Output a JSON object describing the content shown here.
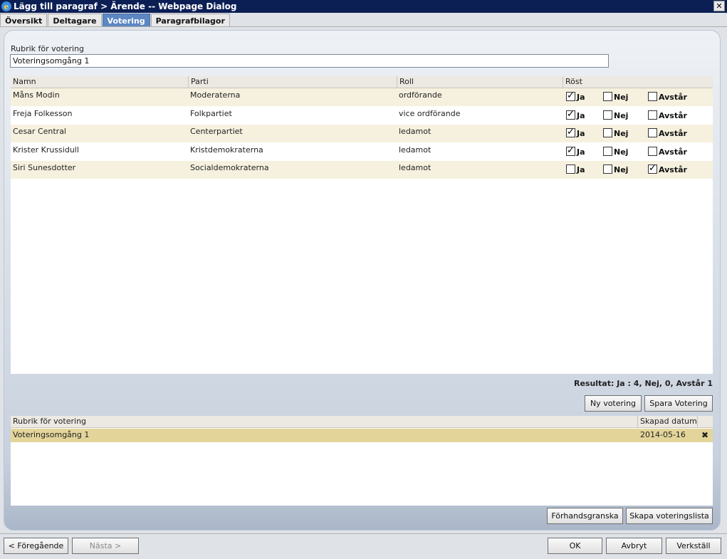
{
  "window": {
    "title": "Lägg till paragraf > Ärende -- Webpage Dialog",
    "close_label": "✕"
  },
  "tabs": [
    "Översikt",
    "Deltagare",
    "Votering",
    "Paragrafbilagor"
  ],
  "form": {
    "rubrik_label": "Rubrik för votering",
    "rubrik_value": "Voteringsomgång 1"
  },
  "votes_table": {
    "headers": [
      "Namn",
      "Parti",
      "Roll",
      "Röst"
    ],
    "vote_labels": [
      "Ja",
      "Nej",
      "Avstår"
    ],
    "rows": [
      {
        "name": "Måns Modin",
        "party": "Moderaterna",
        "role": "ordförande",
        "ja": true,
        "nej": false,
        "avstar": false
      },
      {
        "name": "Freja Folkesson",
        "party": "Folkpartiet",
        "role": "vice ordförande",
        "ja": true,
        "nej": false,
        "avstar": false
      },
      {
        "name": "Cesar Central",
        "party": "Centerpartiet",
        "role": "ledamot",
        "ja": true,
        "nej": false,
        "avstar": false
      },
      {
        "name": "Krister Krussidull",
        "party": "Kristdemokraterna",
        "role": "ledamot",
        "ja": true,
        "nej": false,
        "avstar": false
      },
      {
        "name": "Siri Sunesdotter",
        "party": "Socialdemokraterna",
        "role": "ledamot",
        "ja": false,
        "nej": false,
        "avstar": true
      }
    ]
  },
  "result_text": "Resultat: Ja : 4, Nej, 0, Avstår 1",
  "buttons": {
    "ny_votering": "Ny votering",
    "spara_votering": "Spara Votering",
    "forhandsgranska": "Förhandsgranska",
    "skapa_voteringslista": "Skapa voteringslista",
    "foregaende": "< Föregående",
    "nasta": "Nästa >",
    "ok": "OK",
    "avbryt": "Avbryt",
    "verkstall": "Verkställ"
  },
  "history_table": {
    "headers": [
      "Rubrik för votering",
      "Skapad datum"
    ],
    "rows": [
      {
        "rubrik": "Voteringsomgång 1",
        "datum": "2014-05-16",
        "delete_icon": "✖"
      }
    ]
  },
  "colors": {
    "title_bar": "#0b1f55",
    "active_tab": "#5d87c3",
    "row_alt": "#f6f1df",
    "selected_row": "#e3d59a"
  }
}
